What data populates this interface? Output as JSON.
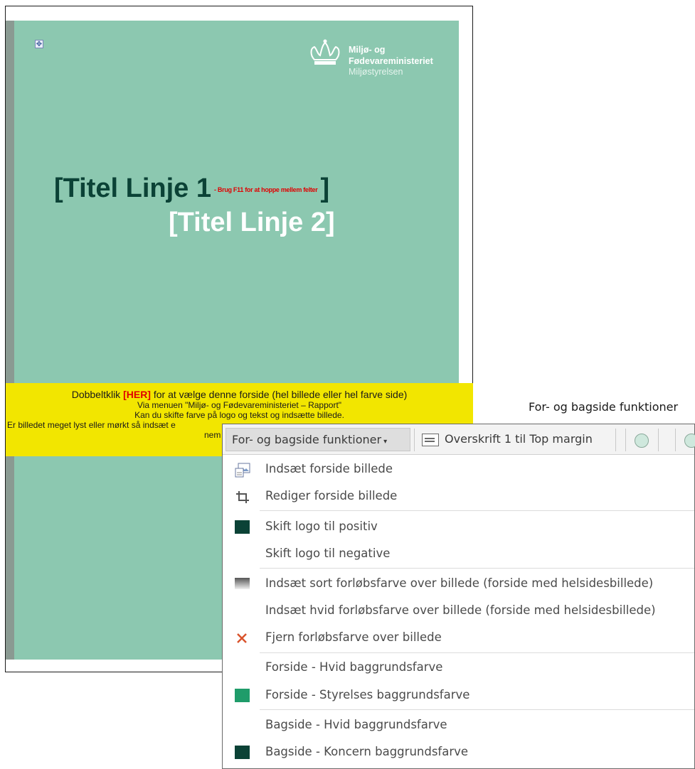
{
  "document": {
    "logo": {
      "line1": "Miljø- og",
      "line2": "Fødevareministeriet",
      "line3": "Miljøstyrelsen"
    },
    "title_line1": "[Titel Linje 1",
    "title_line1_hint": "- Brug F11 for at hoppe mellem felter",
    "title_line1_close": "]",
    "title_line2": "[Titel Linje 2]",
    "instructions": {
      "line1_before": "Dobbeltklik ",
      "line1_her": "[HER]",
      "line1_after": " for at vælge denne forside (hel billede eller hel farve side)",
      "line2": "Via menuen \"Miljø- og Fødevareministeriet – Rapport\"",
      "line3": "Kan du skifte farve på logo og tekst og indsætte billede.",
      "line4": "Er billedet meget lyst eller mørkt så indsæt e",
      "line5": "nem"
    }
  },
  "caption": "For- og bagside funktioner",
  "menu": {
    "toolbar": {
      "dropdown_label": "For- og bagside funktioner",
      "caret": "▾",
      "button2_label": "Overskrift 1 til Top margin"
    },
    "items": [
      {
        "label": "Indsæt forside billede",
        "icon": "insert-image-icon"
      },
      {
        "label": "Rediger forside billede",
        "icon": "crop-icon"
      },
      {
        "label": "Skift logo til positiv",
        "icon": "swatch-dark-green",
        "color": "#0b4236"
      },
      {
        "label": "Skift logo til negative",
        "icon": "none"
      },
      {
        "label": "Indsæt sort forløbsfarve over billede (forside med helsidesbillede)",
        "icon": "gradient-icon"
      },
      {
        "label": "Indsæt hvid forløbsfarve over billede (forside med helsidesbillede)",
        "icon": "none"
      },
      {
        "label": "Fjern forløbsfarve over billede",
        "icon": "close-icon",
        "color": "#d9532c"
      },
      {
        "label": "Forside - Hvid baggrundsfarve",
        "icon": "none"
      },
      {
        "label": "Forside - Styrelses baggrundsfarve",
        "icon": "swatch-green",
        "color": "#1f9c6a"
      },
      {
        "label": "Bagside - Hvid baggrundsfarve",
        "icon": "none"
      },
      {
        "label": "Bagside - Koncern baggrundsfarve",
        "icon": "swatch-dark-green",
        "color": "#0b4236"
      }
    ]
  },
  "colors": {
    "cover_green": "#8cc8b0",
    "title_dark": "#0b4236",
    "instruction_yellow": "#f2e600",
    "accent_red": "#e00000"
  }
}
